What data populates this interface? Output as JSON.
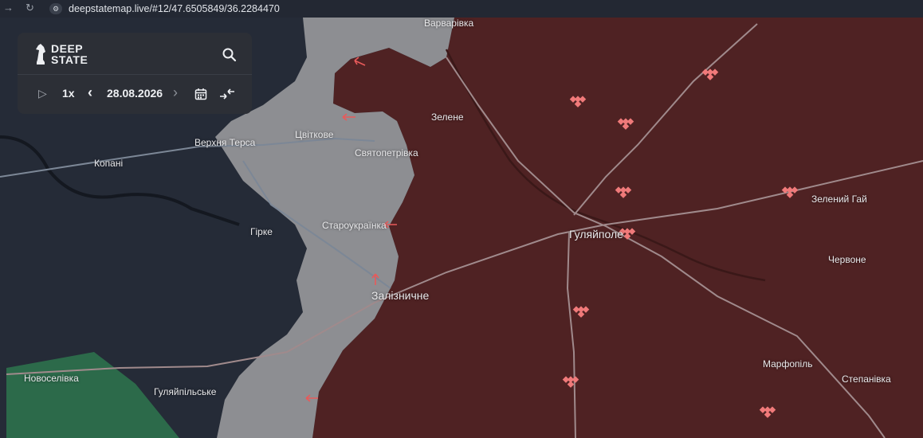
{
  "browser": {
    "url": "deepstatemap.live/#12/47.6505849/36.2284470",
    "back_icon": "→",
    "reload_icon": "↻",
    "site_info_icon": "⚙"
  },
  "panel": {
    "logo_line1": "DEEP",
    "logo_line2": "STATE",
    "speed": "1x",
    "date": "28.08.2026",
    "play_icon": "▷",
    "prev_icon": "‹",
    "next_icon": "›"
  },
  "places": {
    "varvarivka": "Варварівка",
    "zelene": "Зелене",
    "tsvitkove": "Цвіткове",
    "verkhnia_tersa": "Верхня Терса",
    "kopani": "Копані",
    "sviatopetrivka": "Святопетрівка",
    "zelenyi_hai": "Зелений Гай",
    "starоukrainka": "Староукраїнка",
    "hirke": "Гірке",
    "huliaipole": "Гуляйполе",
    "chervone": "Червоне",
    "zaliznychne": "Залізничне",
    "marfopil": "Марфопіль",
    "novoselivka": "Новоселівка",
    "stepanivka": "Степанівка",
    "huliaipilske": "Гуляйпільське"
  },
  "colors": {
    "occupied": "#4f2223",
    "contested": "#8d8e92",
    "free": "#252b37",
    "liberated": "#2c6a4a",
    "arrow": "#e85a5a",
    "marker": "#f07a7a"
  }
}
